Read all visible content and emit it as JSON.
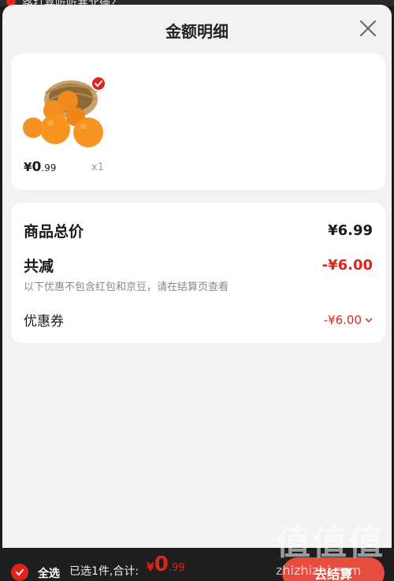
{
  "header_peek": "路打喜听听寒北俩？",
  "sheet": {
    "title": "金额明细"
  },
  "product": {
    "price_yen": "¥",
    "price_int": "0",
    "price_dec": ".99",
    "quantity": "x1"
  },
  "summary": {
    "total_label": "商品总价",
    "total_value": "¥6.99",
    "reduce_label": "共减",
    "reduce_value": "-¥6.00",
    "note": "以下优惠不包含红包和京豆，请在结算页查看",
    "coupon_label": "优惠券",
    "coupon_value": "-¥6.00"
  },
  "bottom_bar": {
    "select_all": "全选",
    "selected_info": "已选1件,合计:",
    "price_yen": "¥",
    "price_int": "0",
    "price_dec": ".99",
    "checkout": "去结算"
  },
  "watermark": {
    "glyphs": "值值值",
    "url": "zhizhizhi.com"
  },
  "colors": {
    "accent": "#e2231a",
    "sheet_bg": "#f2f2f2",
    "bar_bg": "#1e1e1e"
  },
  "icons": [
    "close-icon",
    "check-icon",
    "chevron-down-icon"
  ]
}
